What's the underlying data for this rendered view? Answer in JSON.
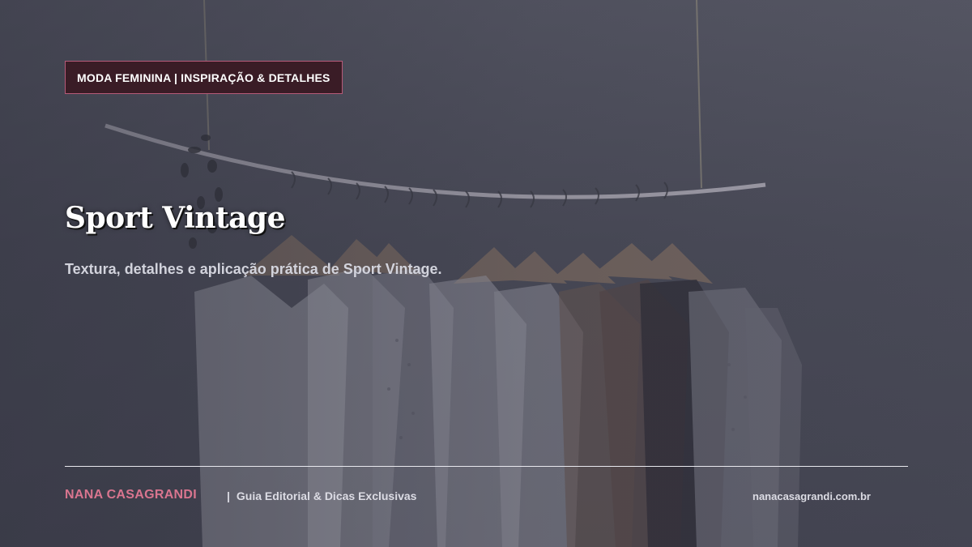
{
  "hero": {
    "category_tag": "MODA FEMININA | INSPIRAÇÃO & DETALHES",
    "title": "Sport Vintage",
    "subtitle": "Textura, detalhes e aplicação prática de Sport Vintage."
  },
  "footer": {
    "brand": "NANA CASAGRANDI",
    "separator": "|",
    "tagline": "Guia Editorial & Dicas Exclusivas",
    "website": "nanacasagrandi.com.br"
  },
  "colors": {
    "background": "#4b4c5a",
    "tag_background": "#3a1c26",
    "tag_border": "#b65a78",
    "brand_accent": "#d9758f",
    "text_primary": "#ffffff",
    "text_secondary": "#d2d3dc"
  },
  "background_image": "clothes-rack-photo"
}
